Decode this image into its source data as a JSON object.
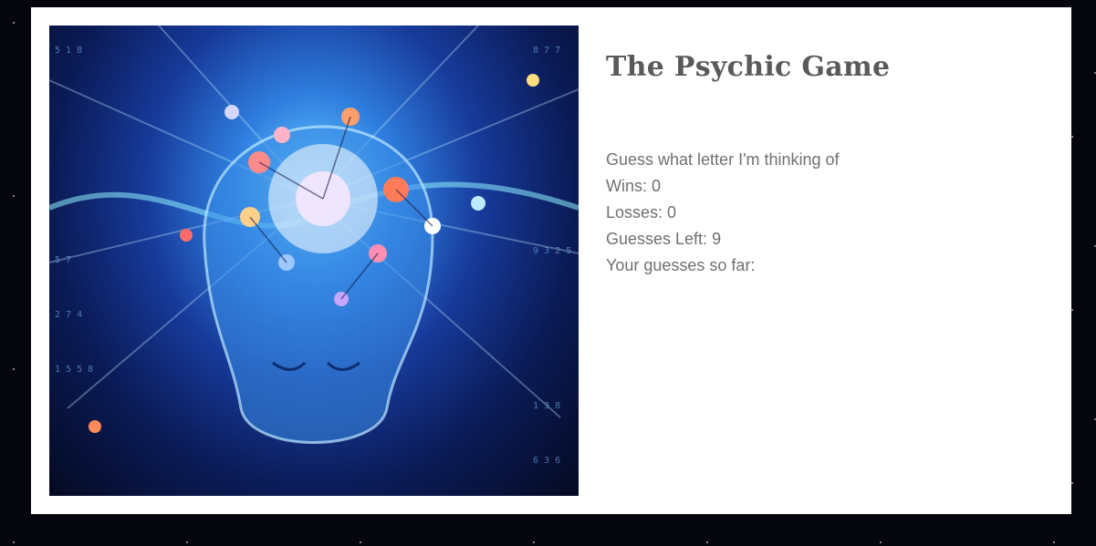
{
  "page": {
    "title": "The Psychic Game"
  },
  "image": {
    "icon": "glowing-brain-head-illustration"
  },
  "game": {
    "prompt": "Guess what letter I'm thinking of",
    "wins_label": "Wins: ",
    "wins": "0",
    "losses_label": "Losses: ",
    "losses": "0",
    "guesses_left_label": "Guesses Left: ",
    "guesses_left": "9",
    "guesses_so_far_label": "Your guesses so far: ",
    "guesses_so_far": ""
  },
  "colors": {
    "page_background": "#05050d",
    "panel_background": "#ffffff",
    "title_text": "#5a5a5a",
    "body_text": "#707070"
  }
}
